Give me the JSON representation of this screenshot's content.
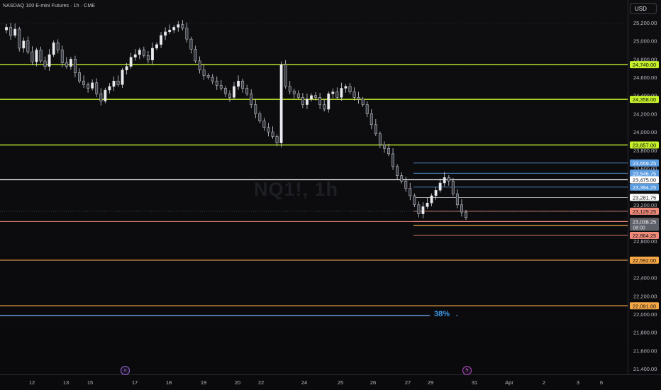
{
  "header": {
    "title": "NASDAQ 100 E-mini Futures · 1h · CME",
    "currency": "USD"
  },
  "watermark": "NQ1!, 1h",
  "percent_marker": "38%",
  "colors": {
    "green_level": "#c6f12b",
    "orange_level": "#f7a846",
    "white_level": "#ffffff",
    "blue_level": "#5a9be0",
    "salmon_level": "#f08a7a",
    "blue_fib": "#6fa4e8"
  },
  "chart_data": {
    "type": "candlestick",
    "title": "",
    "xlabel": "",
    "ylabel": "",
    "ylim": [
      21300,
      25380
    ],
    "x_ticks": [
      "12",
      "13",
      "15",
      "17",
      "18",
      "19",
      "20",
      "22",
      "24",
      "25",
      "26",
      "27",
      "29",
      "31",
      "Apr",
      "2",
      "3",
      "6"
    ],
    "y_ticks": [
      "25,200.00",
      "25,000.00",
      "24,800.00",
      "24,600.00",
      "24,400.00",
      "24,200.00",
      "24,000.00",
      "23,800.00",
      "23,600.00",
      "23,400.00",
      "23,200.00",
      "23,000.00",
      "22,800.00",
      "22,600.00",
      "22,400.00",
      "22,200.00",
      "22,000.00",
      "21,800.00",
      "21,600.00",
      "21,400.00"
    ],
    "y_tick_values": [
      25200,
      25000,
      24800,
      24600,
      24400,
      24200,
      24000,
      23800,
      23600,
      23400,
      23200,
      23000,
      22800,
      22600,
      22400,
      22200,
      22000,
      21800,
      21600,
      21400
    ],
    "price_path": [
      25120,
      25150,
      25060,
      25130,
      24920,
      25000,
      24880,
      24770,
      24900,
      24780,
      24720,
      24850,
      24980,
      24900,
      24760,
      24720,
      24800,
      24650,
      24560,
      24520,
      24480,
      24540,
      24420,
      24340,
      24460,
      24500,
      24560,
      24520,
      24680,
      24720,
      24820,
      24850,
      24900,
      24840,
      24790,
      24920,
      24960,
      25060,
      25100,
      25120,
      25150,
      25180,
      25140,
      25020,
      24910,
      24780,
      24680,
      24620,
      24600,
      24560,
      24510,
      24480,
      24420,
      24380,
      24500,
      24560,
      24480,
      24420,
      24300,
      24200,
      24120,
      24050,
      24000,
      23950,
      23880,
      24740,
      24500,
      24450,
      24420,
      24380,
      24300,
      24360,
      24400,
      24380,
      24300,
      24250,
      24420,
      24440,
      24380,
      24480,
      24500,
      24440,
      24380,
      24360,
      24300,
      24200,
      24080,
      23980,
      23860,
      23820,
      23760,
      23620,
      23520,
      23460,
      23380,
      23300,
      23200,
      23100,
      23180,
      23220,
      23300,
      23360,
      23440,
      23500,
      23460,
      23320,
      23200,
      23120,
      23060
    ],
    "levels": [
      {
        "value": 24740.0,
        "label": "24,740.00",
        "kind": "green"
      },
      {
        "value": 24358.0,
        "label": "24,358.00",
        "kind": "green"
      },
      {
        "value": 23857.0,
        "label": "23,857.00",
        "kind": "green"
      },
      {
        "value": 23659.25,
        "label": "23,659.25",
        "kind": "blue"
      },
      {
        "value": 23546.75,
        "label": "23,546.75",
        "kind": "blue"
      },
      {
        "value": 23475.0,
        "label": "23,475.00",
        "kind": "white"
      },
      {
        "value": 23394.25,
        "label": "23,394.25",
        "kind": "blue"
      },
      {
        "value": 23281.75,
        "label": "23,281.75",
        "kind": "white_thin"
      },
      {
        "value": 23129.25,
        "label": "23,129.25",
        "kind": "salmon"
      },
      {
        "value": 23016.75,
        "label": "23,016.75",
        "kind": "salmon"
      },
      {
        "value": 22974.0,
        "label": "22,974.00",
        "kind": "orange"
      },
      {
        "value": 22864.25,
        "label": "22,864.25",
        "kind": "salmon"
      },
      {
        "value": 22592.0,
        "label": "22,592.00",
        "kind": "orange"
      },
      {
        "value": 22091.0,
        "label": "22,091.00",
        "kind": "orange"
      }
    ],
    "last_price": {
      "value": 23038.25,
      "label": "23,038.25",
      "countdown": "08:00"
    },
    "fib_level": {
      "value": 22000,
      "label": "38%"
    }
  }
}
